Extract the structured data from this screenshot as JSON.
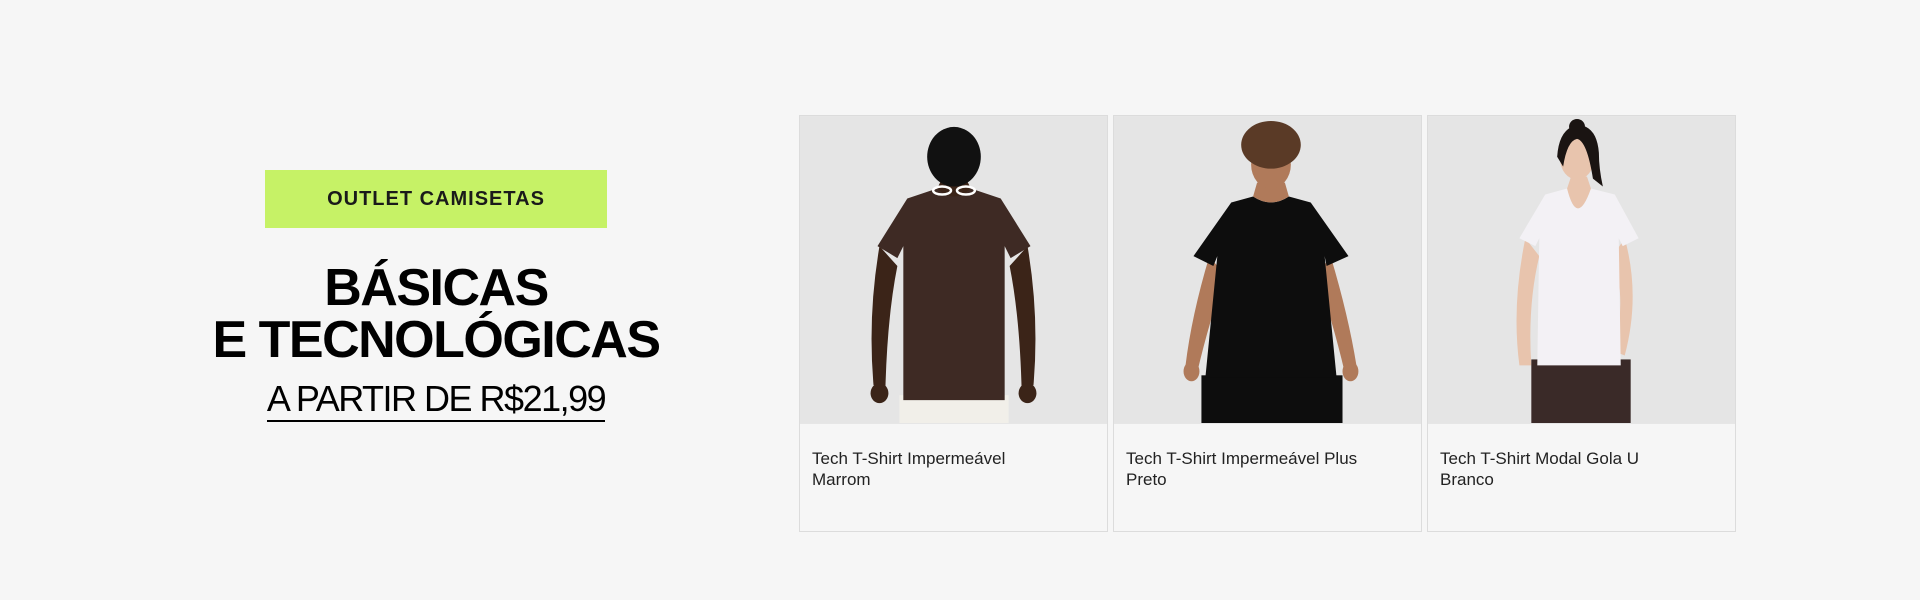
{
  "promo": {
    "badge_label": "OUTLET CAMISETAS",
    "headline_line1": "BÁSICAS",
    "headline_line2": "E TECNOLÓGICAS",
    "price_link": "A PARTIR DE R$21,99",
    "badge_color": "#c6f266"
  },
  "products": [
    {
      "name": "Tech T-Shirt Impermeável Marrom",
      "shirt_color": "#3e2a24",
      "photo": "man-brown-tshirt"
    },
    {
      "name": "Tech T-Shirt Impermeável Plus Preto",
      "shirt_color": "#0d0d0d",
      "photo": "woman-black-tshirt"
    },
    {
      "name": "Tech T-Shirt Modal Gola U Branco",
      "shirt_color": "#f3f1f5",
      "photo": "woman-white-tshirt"
    }
  ]
}
